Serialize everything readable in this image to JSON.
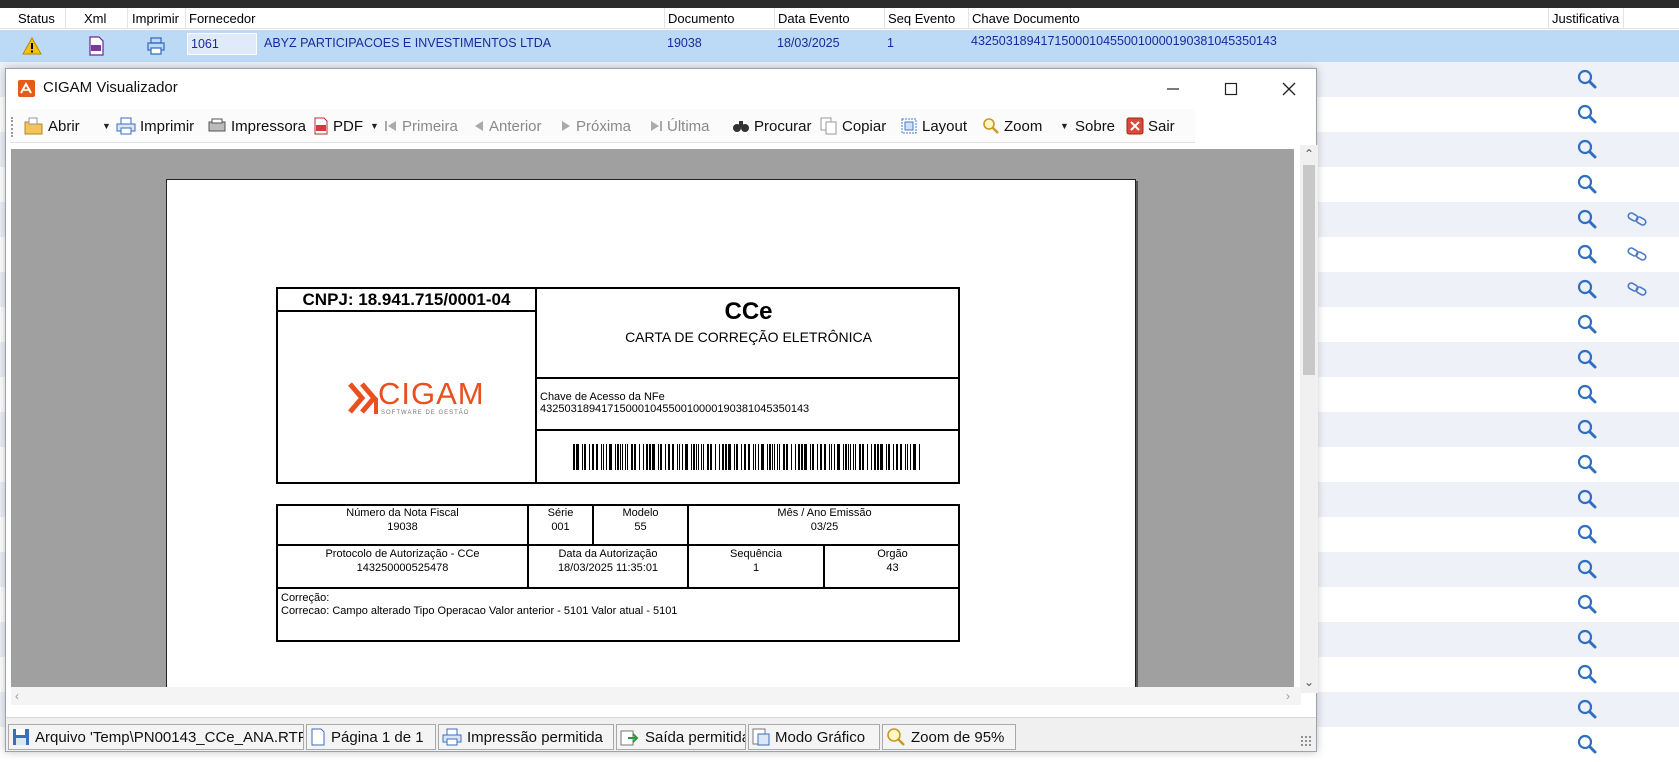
{
  "grid": {
    "columns": {
      "status": "Status",
      "xml": "Xml",
      "imprimir": "Imprimir",
      "fornecedor": "Fornecedor",
      "documento": "Documento",
      "data_evento": "Data Evento",
      "seq_evento": "Seq Evento",
      "chave_documento": "Chave Documento",
      "justificativa": "Justificativa"
    },
    "selected_row": {
      "fornecedor_code": "1061",
      "fornecedor_name": "ABYZ PARTICIPACOES E INVESTIMENTOS LTDA",
      "documento": "19038",
      "data_evento": "18/03/2025",
      "seq_evento": "1",
      "chave_documento": "43250318941715000104550010000190381045350143"
    },
    "colors": {
      "selected": "#bcd9f5",
      "alt_row": "#eef1f8",
      "link_text": "#1a2a9c"
    }
  },
  "viewer": {
    "title": "CIGAM Visualizador",
    "toolbar": {
      "abrir": "Abrir",
      "imprimir": "Imprimir",
      "impressora": "Impressora",
      "pdf": "PDF",
      "primeira": "Primeira",
      "anterior": "Anterior",
      "proxima": "Próxima",
      "ultima": "Última",
      "procurar": "Procurar",
      "copiar": "Copiar",
      "layout": "Layout",
      "zoom": "Zoom",
      "sobre": "Sobre",
      "sair": "Sair"
    },
    "statusbar": {
      "arquivo": "Arquivo 'Temp\\PN00143_CCe_ANA.RTF'",
      "pagina": "Página 1 de 1",
      "impressao": "Impressão permitida",
      "saida": "Saída permitida",
      "modo": "Modo Gráfico",
      "zoom": "Zoom de 95%"
    }
  },
  "report": {
    "cnpj": "CNPJ: 18.941.715/0001-04",
    "title": "CCe",
    "subtitle": "CARTA DE CORREÇÃO ELETRÔNICA",
    "logo_text": "CIGAM",
    "logo_tagline": "SOFTWARE DE GESTÃO",
    "chave_label": "Chave de Acesso da NFe",
    "chave_value": "43250318941715000104550010000190381045350143",
    "numero_label": "Número da Nota Fiscal",
    "numero_value": "19038",
    "serie_label": "Série",
    "serie_value": "001",
    "modelo_label": "Modelo",
    "modelo_value": "55",
    "mes_label": "Mês / Ano Emissão",
    "mes_value": "03/25",
    "protocolo_label": "Protocolo de Autorização - CCe",
    "protocolo_value": "143250000525478",
    "data_aut_label": "Data da Autorização",
    "data_aut_value": "18/03/2025 11:35:01",
    "sequencia_label": "Sequência",
    "sequencia_value": "1",
    "orgao_label": "Orgão",
    "orgao_value": "43",
    "correcao_label": "Correção:",
    "correcao_value": "Correcao: Campo alterado Tipo Operacao Valor anterior  - 5101 Valor atual  - 5101",
    "logo_color": "#e8501f"
  }
}
